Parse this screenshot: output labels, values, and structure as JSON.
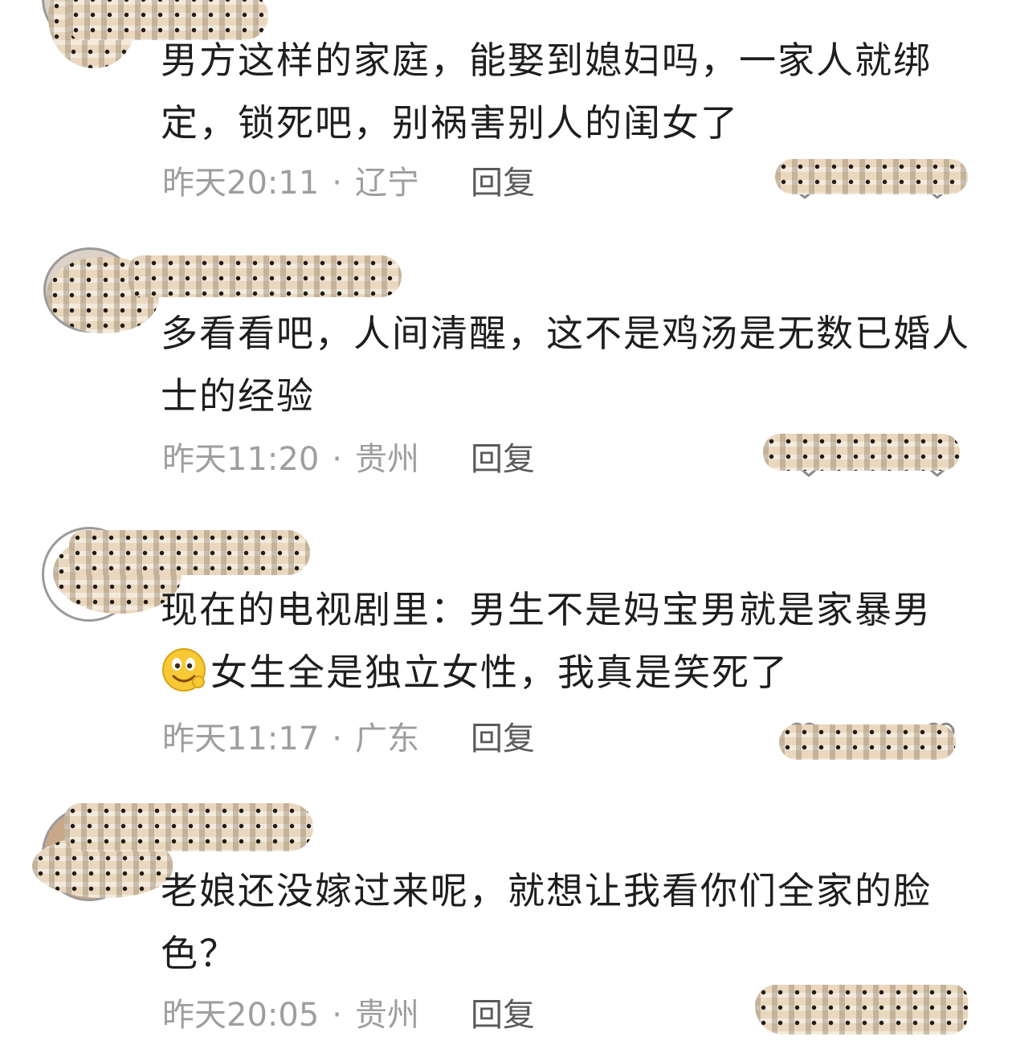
{
  "comments": [
    {
      "text": "男方这样的家庭，能娶到媳妇吗，一家人就绑定，锁死吧，别祸害别人的闺女了",
      "time": "昨天20:11",
      "separator": "·",
      "location": "辽宁",
      "reply_label": "回复"
    },
    {
      "text": "多看看吧，人间清醒，这不是鸡汤是无数已婚人士的经验",
      "time": "昨天11:20",
      "separator": "·",
      "location": "贵州",
      "reply_label": "回复"
    },
    {
      "text_after_emoji": "女生全是独立女性，我真是笑死了",
      "text": "现在的电视剧里：男生不是妈宝男就是家暴男",
      "emoji": "smiley-emoji",
      "time": "昨天11:17",
      "separator": "·",
      "location": "广东",
      "reply_label": "回复"
    },
    {
      "text": "老娘还没嫁过来呢，就想让我看你们全家的脸色？",
      "time": "昨天20:05",
      "separator": "·",
      "location": "贵州",
      "reply_label": "回复"
    }
  ],
  "icons": {
    "like": "heart-outline-icon",
    "dislike": "heart-outline-icon"
  },
  "colors": {
    "text": "#1e1e1e",
    "meta": "#9e9e9e",
    "reply": "#5a5a5a",
    "censor_mosaic": "#e9d8bf"
  }
}
